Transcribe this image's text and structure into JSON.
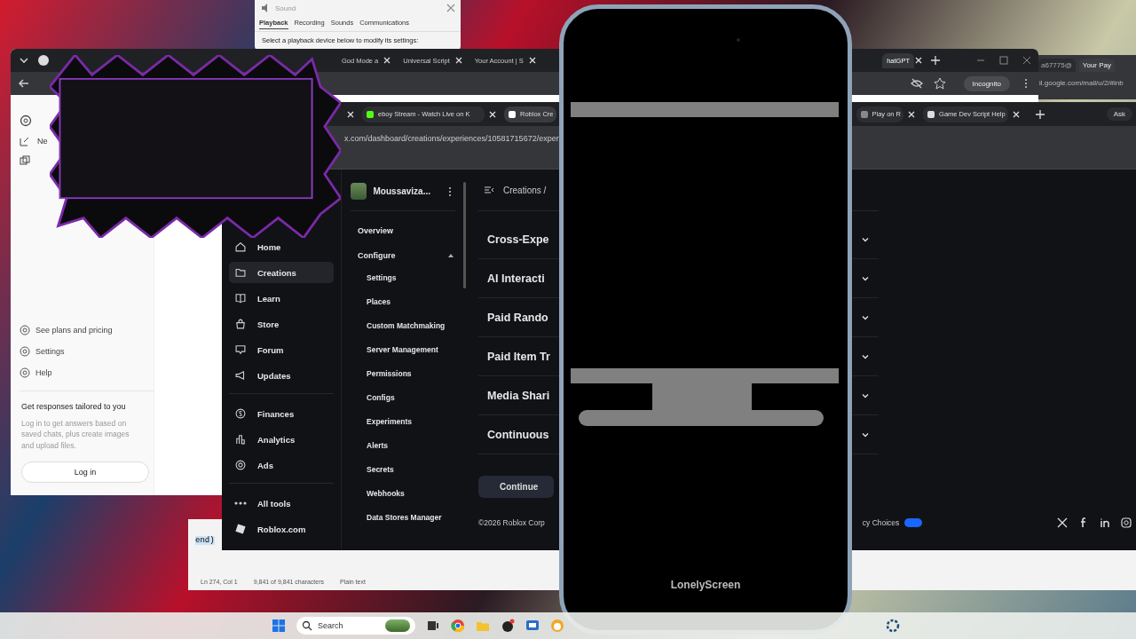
{
  "sound_window": {
    "title": "Sound",
    "tabs": [
      {
        "label": "Playback",
        "selected": true
      },
      {
        "label": "Recording",
        "selected": false
      },
      {
        "label": "Sounds",
        "selected": false
      },
      {
        "label": "Communications",
        "selected": false
      }
    ],
    "prompt": "Select a playback device below to modify its settings:"
  },
  "back_browser": {
    "tabs": [
      {
        "label": "God Mode a",
        "selected": false
      },
      {
        "label": "Universal Script",
        "selected": false
      },
      {
        "label": "Your Account | S",
        "selected": false
      },
      {
        "label": "hatGPT",
        "selected": true
      }
    ],
    "incognito": "Incognito"
  },
  "chat_sidebar": {
    "new_chat": "Ne",
    "items": [
      "See plans and pricing",
      "Settings",
      "Help"
    ],
    "promo_title": "Get responses tailored to you",
    "promo_text": "Log in to get answers based on saved chats, plus create images and upload files.",
    "login": "Log in"
  },
  "gmail_window": {
    "tabs": [
      {
        "label": "a67775@",
        "selected": false
      },
      {
        "label": "Your Pay",
        "selected": true
      }
    ],
    "address": "il.google.com/mail/u/2/#inb"
  },
  "roblox_browser": {
    "tabs": [
      {
        "label": "eboy Stream - Watch Live on K",
        "selected": false
      },
      {
        "label": "Roblox Cre",
        "selected": true
      },
      {
        "label": "Play on R",
        "selected": false
      },
      {
        "label": "Game Dev Script Help",
        "selected": false
      }
    ],
    "ask": "Ask",
    "address": "x.com/dashboard/creations/experiences/10581715672/exper"
  },
  "nav": {
    "primary": [
      {
        "label": "Home",
        "selected": false
      },
      {
        "label": "Creations",
        "selected": true
      },
      {
        "label": "Learn",
        "selected": false
      },
      {
        "label": "Store",
        "selected": false
      },
      {
        "label": "Forum",
        "selected": false
      },
      {
        "label": "Updates",
        "selected": false
      }
    ],
    "secondary": [
      {
        "label": "Finances",
        "selected": false
      },
      {
        "label": "Analytics",
        "selected": false
      },
      {
        "label": "Ads",
        "selected": false
      }
    ],
    "all_tools": "All tools",
    "site": "Roblox.com"
  },
  "subnav": {
    "project": "Moussaviza...",
    "items": [
      {
        "label": "Overview"
      },
      {
        "label": "Configure",
        "expanded": true,
        "children": [
          {
            "label": "Settings"
          },
          {
            "label": "Places"
          },
          {
            "label": "Custom Matchmaking"
          },
          {
            "label": "Server Management"
          },
          {
            "label": "Permissions"
          },
          {
            "label": "Configs"
          },
          {
            "label": "Experiments"
          },
          {
            "label": "Alerts"
          },
          {
            "label": "Secrets"
          },
          {
            "label": "Webhooks"
          },
          {
            "label": "Data Stores Manager"
          }
        ]
      }
    ]
  },
  "main": {
    "breadcrumb": "Creations /",
    "sections": [
      {
        "title": "Cross-Expe",
        "expanded": false
      },
      {
        "title": "AI Interacti",
        "expanded": false
      },
      {
        "title": "Paid Rando",
        "expanded": false
      },
      {
        "title": "Paid Item Tr",
        "expanded": false
      },
      {
        "title": "Media Shari",
        "expanded": false
      },
      {
        "title": "Continuous",
        "expanded": false
      }
    ],
    "continue": "Continue",
    "copyright": "©2026 Roblox Corp",
    "privacy": "cy Choices",
    "privacy_toggle": {
      "on": true
    }
  },
  "notepad": {
    "line": "end)",
    "position": "Ln 274, Col 1",
    "characters": "9,841 of 9,841 characters",
    "format": "Plain text"
  },
  "phone": {
    "label": "LonelyScreen"
  },
  "taskbar": {
    "search": "Search"
  }
}
